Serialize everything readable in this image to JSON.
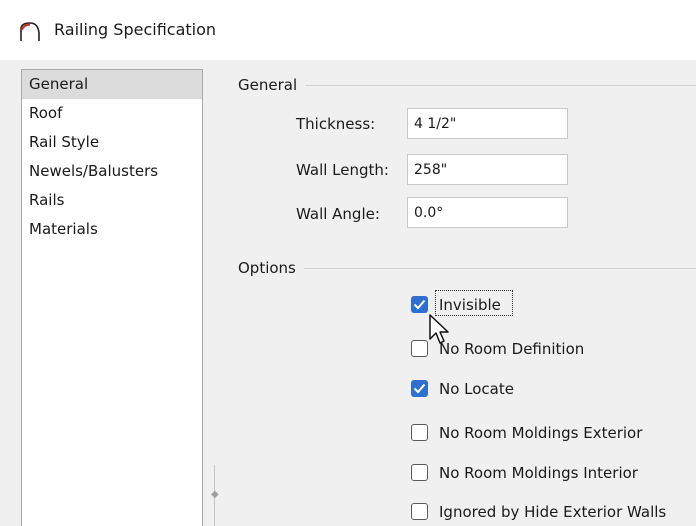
{
  "window": {
    "title": "Railing Specification",
    "icon": "railing-arch-icon"
  },
  "sidebar": {
    "items": [
      {
        "label": "General",
        "selected": true
      },
      {
        "label": "Roof",
        "selected": false
      },
      {
        "label": "Rail Style",
        "selected": false
      },
      {
        "label": "Newels/Balusters",
        "selected": false
      },
      {
        "label": "Rails",
        "selected": false
      },
      {
        "label": "Materials",
        "selected": false
      }
    ]
  },
  "general": {
    "heading": "General",
    "thickness_label": "Thickness:",
    "thickness_value": "4 1/2\"",
    "wall_length_label": "Wall Length:",
    "wall_length_value": "258\"",
    "wall_angle_label": "Wall Angle:",
    "wall_angle_value": "0.0°"
  },
  "options": {
    "heading": "Options",
    "items": [
      {
        "label": "Invisible",
        "checked": true
      },
      {
        "label": "No Room Definition",
        "checked": false
      },
      {
        "label": "No Locate",
        "checked": true
      },
      {
        "label": "No Room Moldings Exterior",
        "checked": false
      },
      {
        "label": "No Room Moldings Interior",
        "checked": false
      },
      {
        "label": "Ignored by Hide Exterior Walls",
        "checked": false
      }
    ]
  },
  "colors": {
    "accent": "#2f6fd0",
    "selected_item_bg": "#dcdcdc",
    "dialog_bg": "#f0f0f0"
  }
}
